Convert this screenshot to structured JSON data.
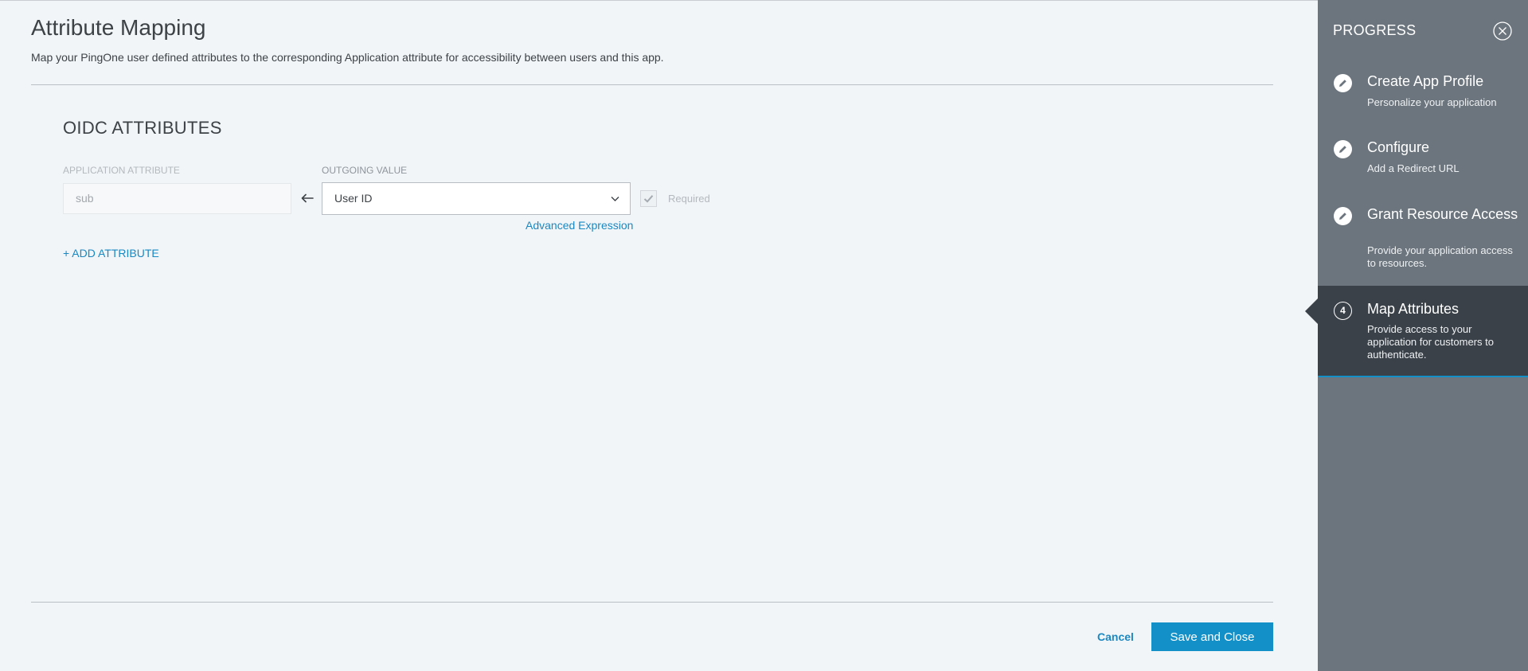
{
  "page": {
    "title": "Attribute Mapping",
    "description": "Map your PingOne user defined attributes to the corresponding Application attribute for accessibility between users and this app."
  },
  "section": {
    "title": "OIDC ATTRIBUTES",
    "col_application": "APPLICATION ATTRIBUTE",
    "col_outgoing": "OUTGOING VALUE"
  },
  "mapping": {
    "attribute": "sub",
    "outgoing_value": "User ID",
    "required_label": "Required",
    "required_checked": true,
    "advanced_link": "Advanced Expression"
  },
  "add_attribute": "+ ADD ATTRIBUTE",
  "footer": {
    "cancel": "Cancel",
    "save": "Save and Close"
  },
  "progress": {
    "title": "PROGRESS",
    "steps": [
      {
        "title": "Create App Profile",
        "sub": "Personalize your application",
        "icon": "pencil-icon"
      },
      {
        "title": "Configure",
        "sub": "Add a Redirect URL",
        "icon": "pencil-icon"
      },
      {
        "title": "Grant Resource Access",
        "sub": "Provide your application access to resources.",
        "icon": "pencil-icon"
      },
      {
        "number": "4",
        "title": "Map Attributes",
        "sub": "Provide access to your application for customers to authenticate.",
        "active": true
      }
    ]
  },
  "colors": {
    "accent": "#1390c8",
    "link": "#1b88c2",
    "side_panel": "#6c757d",
    "side_active": "#3a4149",
    "background": "#f1f5f8"
  }
}
